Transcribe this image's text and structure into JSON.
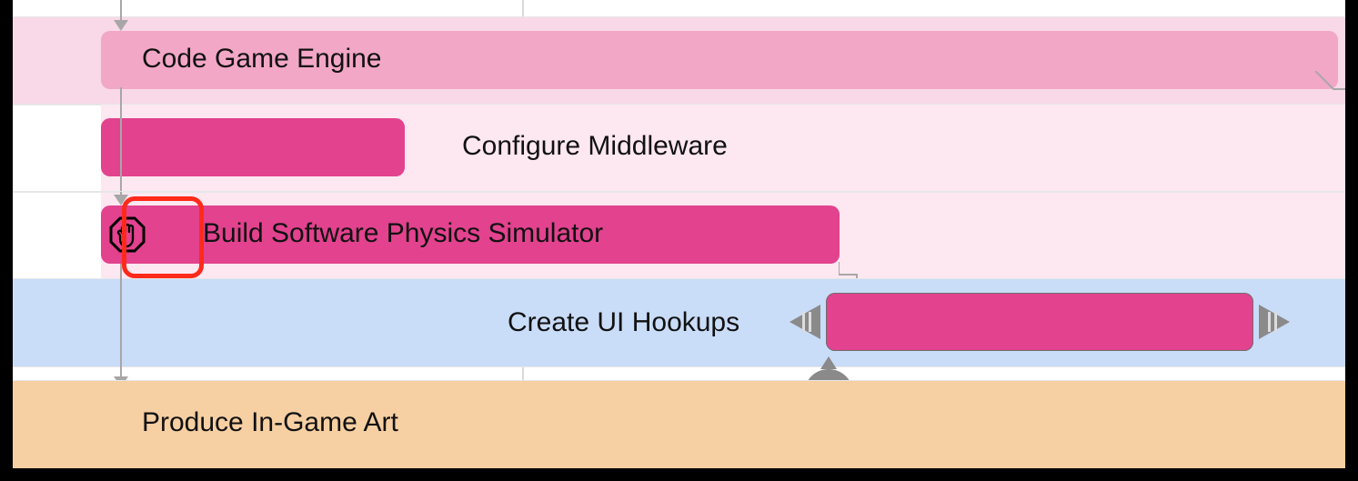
{
  "tasks": {
    "code_engine": "Code Game Engine",
    "configure_mw": "Configure Middleware",
    "build_physics": "Build Software Physics Simulator",
    "ui_hookups": "Create UI Hookups",
    "produce_art": "Produce In-Game Art"
  },
  "colors": {
    "pink_light": "#f9d8e8",
    "pink_lighter": "#fde7f1",
    "magenta": "#e2428e",
    "blue_light": "#c9dcf8",
    "orange_light": "#f6cfa2",
    "highlight": "#ff2a1a"
  }
}
